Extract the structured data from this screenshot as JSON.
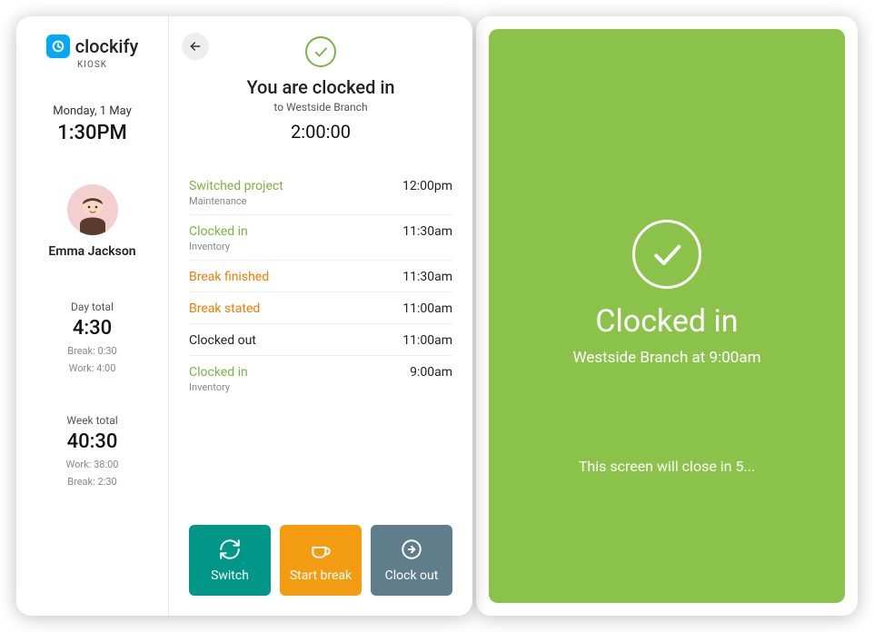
{
  "brand": {
    "name": "clockify",
    "kiosk_label": "KIOSK"
  },
  "sidebar": {
    "date": "Monday, 1 May",
    "time": "1:30PM",
    "user_name": "Emma Jackson",
    "day_label": "Day total",
    "day_total": "4:30",
    "day_break": "Break: 0:30",
    "day_work": "Work: 4:00",
    "week_label": "Week total",
    "week_total": "40:30",
    "week_work": "Work: 38:00",
    "week_break": "Break: 2:30"
  },
  "hero": {
    "title": "You are clocked in",
    "subtitle": "to Westside Branch",
    "elapsed": "2:00:00"
  },
  "events": [
    {
      "title": "Switched project",
      "sub": "Maintenance",
      "time": "12:00pm",
      "style": "green"
    },
    {
      "title": "Clocked in",
      "sub": "Inventory",
      "time": "11:30am",
      "style": "green"
    },
    {
      "title": "Break finished",
      "sub": "",
      "time": "11:30am",
      "style": "orange"
    },
    {
      "title": "Break stated",
      "sub": "",
      "time": "11:00am",
      "style": "orange"
    },
    {
      "title": "Clocked out",
      "sub": "",
      "time": "11:00am",
      "style": "plain"
    },
    {
      "title": "Clocked in",
      "sub": "Inventory",
      "time": "9:00am",
      "style": "green"
    }
  ],
  "actions": {
    "switch": "Switch",
    "break": "Start break",
    "out": "Clock out"
  },
  "confirm": {
    "title": "Clocked in",
    "subtitle": "Westside Branch at 9:00am",
    "closing": "This screen will close in 5..."
  }
}
